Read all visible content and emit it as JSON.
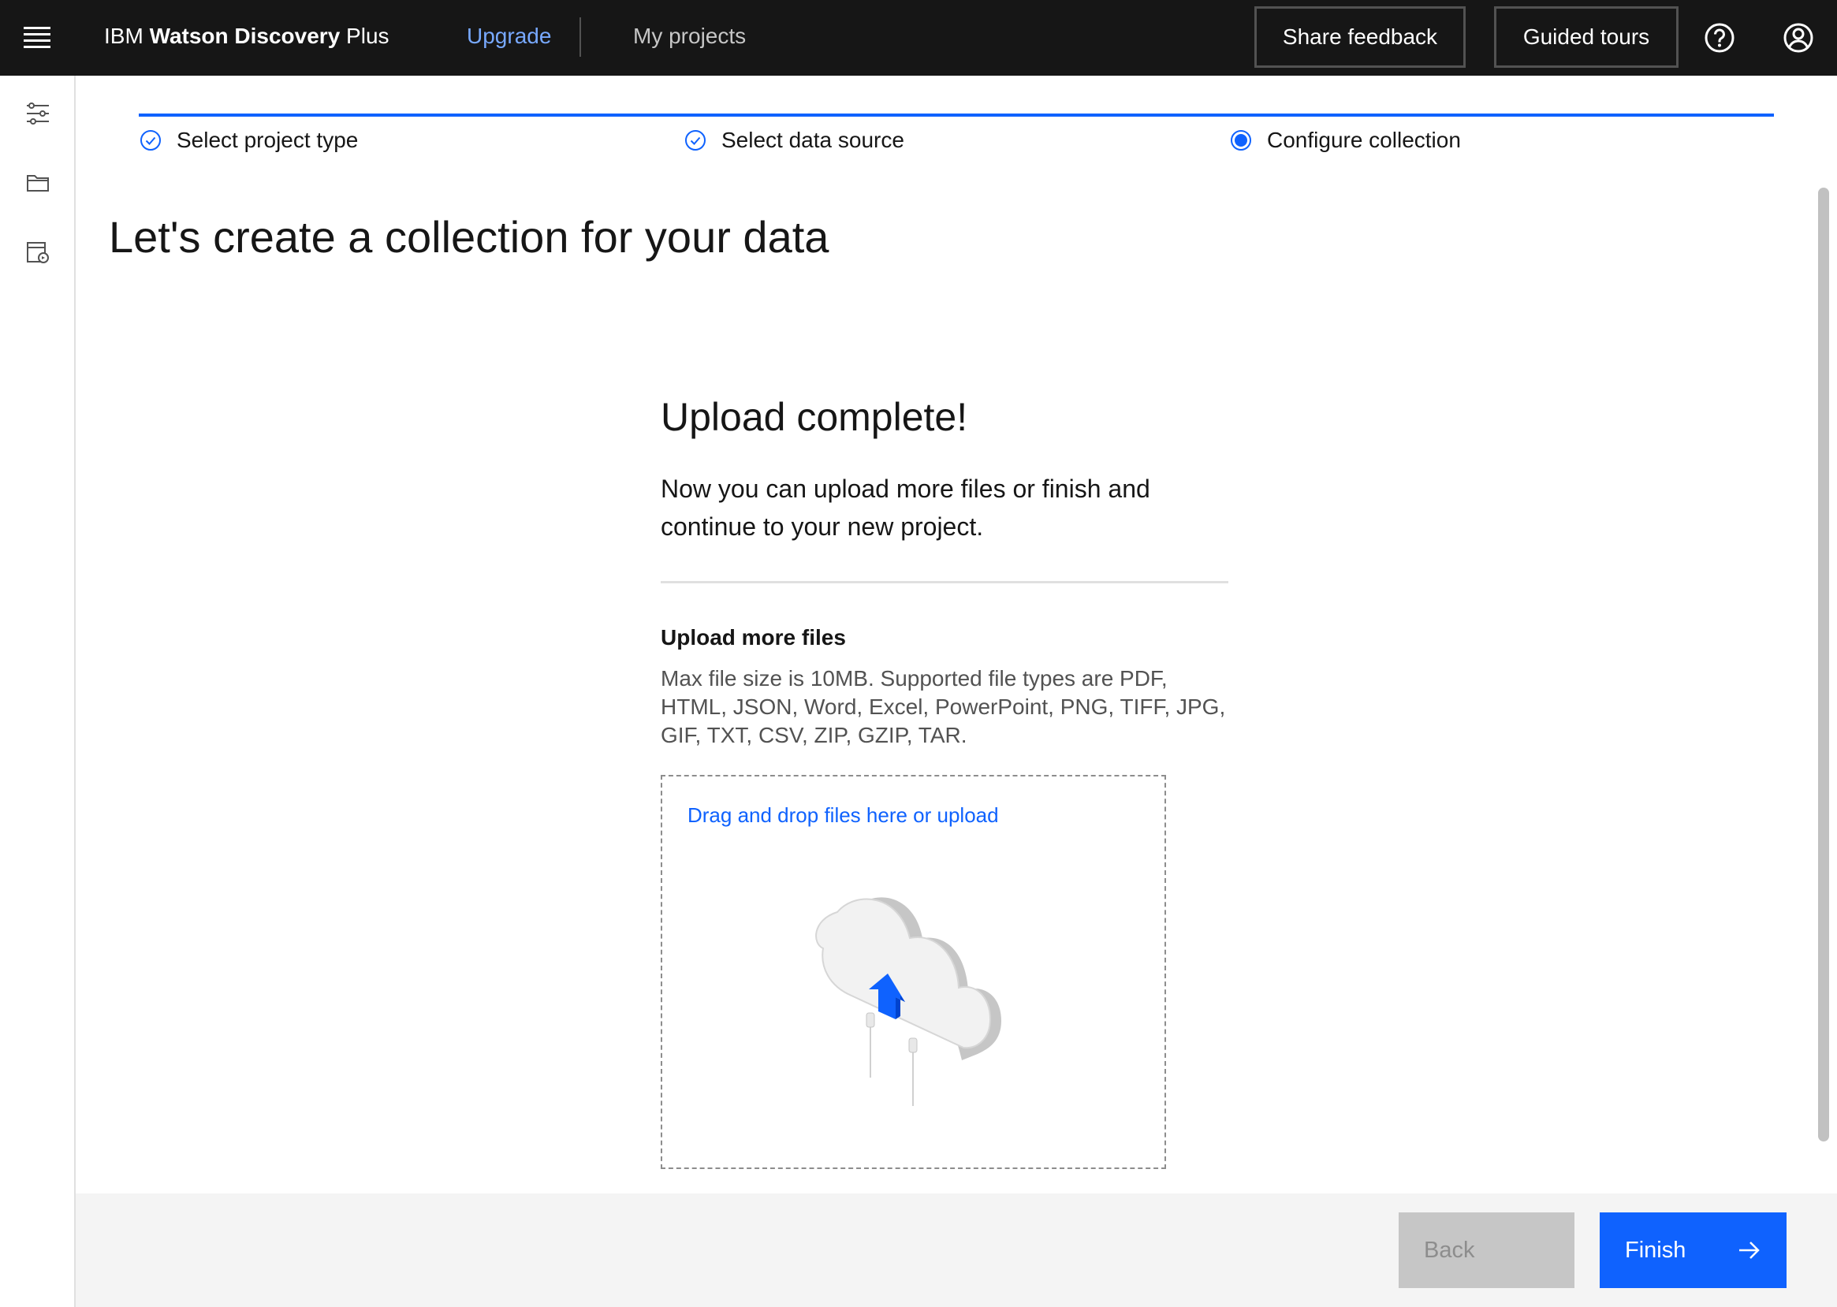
{
  "header": {
    "brand_prefix": "IBM ",
    "brand_bold": "Watson Discovery",
    "brand_suffix": " Plus",
    "upgrade_label": "Upgrade",
    "my_projects_label": "My projects",
    "share_feedback_label": "Share feedback",
    "guided_tours_label": "Guided tours",
    "icons": [
      "menu-icon",
      "help-icon",
      "user-avatar-icon"
    ]
  },
  "sidebar": {
    "icons": [
      "settings-sliders-icon",
      "folder-icon",
      "data-source-icon"
    ]
  },
  "progress": {
    "steps": [
      {
        "label": "Select project type",
        "state": "complete"
      },
      {
        "label": "Select data source",
        "state": "complete"
      },
      {
        "label": "Configure collection",
        "state": "current"
      }
    ]
  },
  "page": {
    "title": "Let's create a collection for your data"
  },
  "upload": {
    "title": "Upload complete!",
    "description": "Now you can upload more files or finish and continue to your new project.",
    "more_title": "Upload more files",
    "more_description": "Max file size is 10MB. Supported file types are PDF, HTML, JSON, Word, Excel, PowerPoint, PNG, TIFF, JPG, GIF, TXT, CSV, ZIP, GZIP, TAR.",
    "dropzone_label": "Drag and drop files here or upload"
  },
  "footer": {
    "back_label": "Back",
    "finish_label": "Finish"
  },
  "colors": {
    "header_bg": "#161616",
    "accent_blue": "#0f62fe",
    "upgrade_link": "#78a9ff",
    "footer_bg": "#f4f4f4",
    "disabled_button": "#c6c6c6"
  }
}
